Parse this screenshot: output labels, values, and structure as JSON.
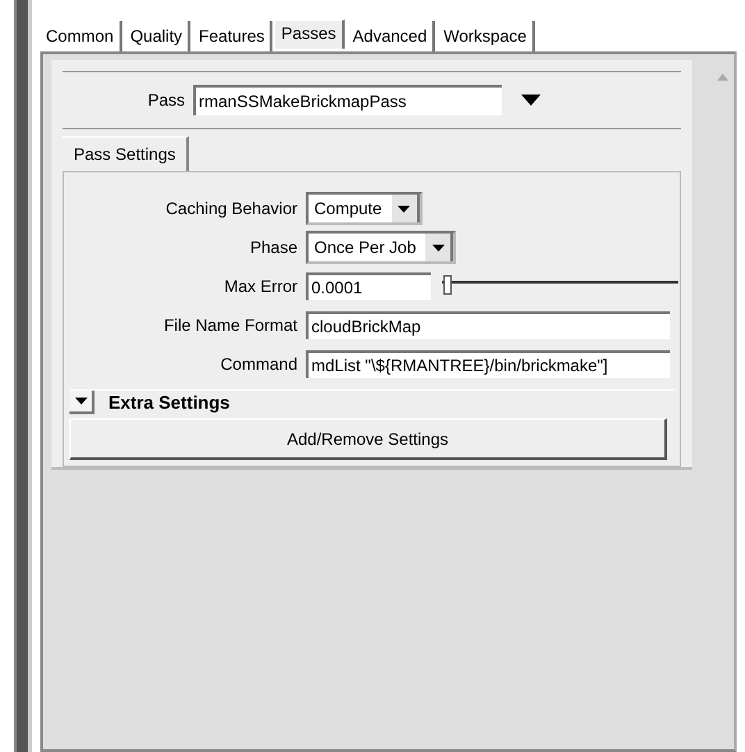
{
  "tabs": [
    {
      "label": "Common",
      "selected": false
    },
    {
      "label": "Quality",
      "selected": false
    },
    {
      "label": "Features",
      "selected": false
    },
    {
      "label": "Passes",
      "selected": true
    },
    {
      "label": "Advanced",
      "selected": false
    },
    {
      "label": "Workspace",
      "selected": false
    }
  ],
  "pass": {
    "label": "Pass",
    "value": "rmanSSMakeBrickmapPass"
  },
  "sub_tabs": [
    {
      "label": "Pass Settings"
    }
  ],
  "settings": [
    {
      "kind": "dropdown",
      "label": "Caching Behavior",
      "value": "Compute"
    },
    {
      "kind": "dropdown",
      "label": "Phase",
      "value": "Once Per Job"
    },
    {
      "kind": "slider",
      "label": "Max Error",
      "value": "0.0001",
      "level": 0.02
    },
    {
      "kind": "text",
      "label": "File Name Format",
      "value": "cloudBrickMap"
    },
    {
      "kind": "text",
      "label": "Command",
      "value": "mdList \"\\${RMANTREE}/bin/brickmake\"]"
    }
  ],
  "extra_settings": {
    "title": "Extra Settings",
    "expanded": true,
    "button": "Add/Remove Settings"
  }
}
